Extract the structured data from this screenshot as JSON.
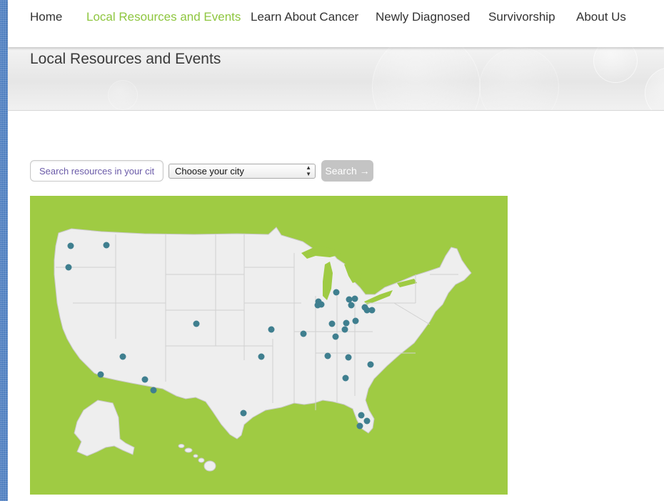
{
  "nav": {
    "items": [
      {
        "label": "Home",
        "active": false
      },
      {
        "label": "Local Resources and Events",
        "active": true
      },
      {
        "label": "Learn About Cancer",
        "active": false
      },
      {
        "label": "Newly Diagnosed",
        "active": false
      },
      {
        "label": "Survivorship",
        "active": false
      },
      {
        "label": "About Us",
        "active": false
      }
    ],
    "active_color": "#8ec63f"
  },
  "banner": {
    "title": "Local Resources and Events"
  },
  "search": {
    "placeholder": "Search resources in your city",
    "city_select_value": "Choose your city",
    "button_label": "Search →"
  },
  "map": {
    "background_color": "#9fcb43",
    "land_color": "#eeeeee",
    "marker_color": "#3f7f8f"
  }
}
